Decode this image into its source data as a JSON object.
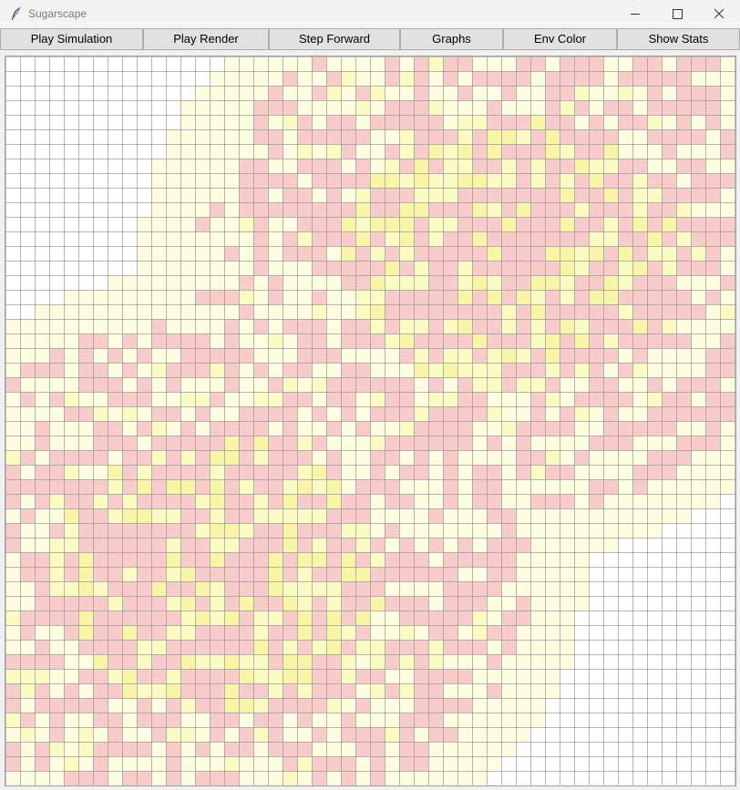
{
  "window": {
    "title": "Sugarscape"
  },
  "toolbar": {
    "buttons": [
      {
        "label": "Play Simulation"
      },
      {
        "label": "Play Render"
      },
      {
        "label": "Step Forward"
      },
      {
        "label": "Graphs"
      },
      {
        "label": "Env Color"
      },
      {
        "label": "Show Stats"
      }
    ]
  },
  "grid": {
    "cols": 50,
    "rows": 50,
    "colors": {
      "empty": "#ffffff",
      "sugar_low": "#fefde0",
      "sugar_mid": "#fcfbc4",
      "sugar_high": "#f8f5a8",
      "agent": "#f9cccc",
      "grid_line": "#9a9a9a"
    }
  }
}
